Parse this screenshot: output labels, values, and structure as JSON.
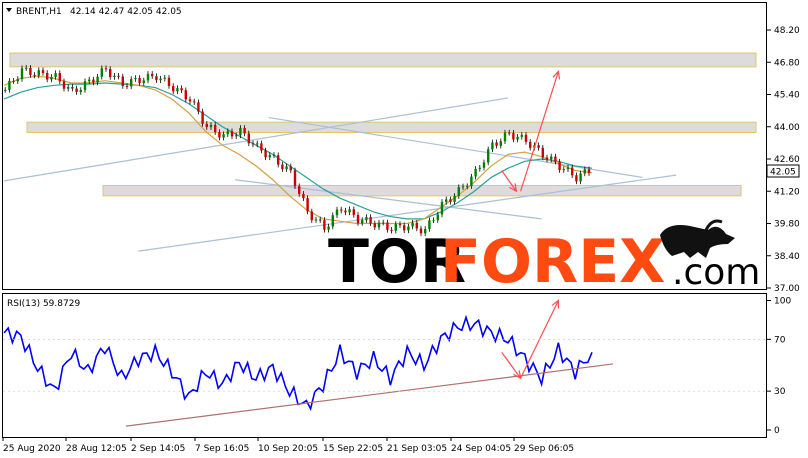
{
  "chart_data": [
    {
      "type": "candlestick",
      "title": "BRENT,H1",
      "ohlc_label": "42.14 42.47 42.05 42.05",
      "last_price": "42.05",
      "y_ticks": [
        "48.20",
        "46.80",
        "45.40",
        "44.00",
        "42.60",
        "41.20",
        "39.80",
        "38.40",
        "37.00"
      ],
      "ylim": [
        37.0,
        48.2
      ],
      "x_ticks": [
        "25 Aug 2020",
        "28 Aug 12:05",
        "2 Sep 14:05",
        "7 Sep 16:05",
        "10 Sep 20:05",
        "15 Sep 22:05",
        "21 Sep 03:05",
        "24 Sep 04:05",
        "29 Sep 06:05"
      ],
      "x": [
        0,
        4,
        8,
        12,
        16,
        20,
        24,
        28,
        32,
        36,
        40,
        44,
        48,
        52,
        56,
        60,
        64,
        68,
        72,
        76,
        80,
        84,
        88,
        92,
        96,
        100,
        104,
        108,
        112,
        116,
        120,
        124,
        128,
        132,
        136,
        140
      ],
      "close": [
        45.6,
        46.45,
        46.3,
        46.15,
        45.5,
        45.95,
        46.5,
        45.85,
        46.05,
        46.2,
        45.7,
        45.2,
        44.0,
        43.6,
        43.8,
        43.1,
        42.6,
        42.0,
        40.3,
        39.6,
        40.5,
        40.0,
        39.8,
        39.6,
        39.7,
        39.5,
        40.6,
        41.2,
        42.0,
        43.2,
        43.7,
        43.4,
        42.8,
        42.3,
        41.8,
        42.2
      ],
      "series": [
        {
          "name": "",
          "color": "#2aa198",
          "values": [
            45.2,
            45.5,
            45.7,
            45.8,
            45.85,
            45.85,
            45.9,
            45.85,
            45.8,
            45.7,
            45.4,
            45.0,
            44.5,
            44.0,
            43.6,
            43.2,
            42.8,
            42.3,
            41.8,
            41.3,
            40.9,
            40.6,
            40.3,
            40.1,
            40.0,
            40.0,
            40.3,
            40.7,
            41.2,
            41.8,
            42.2,
            42.5,
            42.6,
            42.5,
            42.3,
            42.2
          ]
        },
        {
          "name": "",
          "color": "#d4a040",
          "values": [
            45.8,
            46.1,
            46.2,
            46.1,
            45.9,
            45.9,
            46.0,
            45.9,
            45.8,
            45.6,
            45.2,
            44.6,
            43.8,
            43.2,
            42.8,
            42.3,
            41.7,
            41.0,
            40.4,
            40.0,
            39.9,
            39.8,
            39.8,
            39.8,
            39.8,
            40.0,
            40.5,
            41.0,
            41.6,
            42.3,
            42.8,
            42.9,
            42.7,
            42.4,
            42.1,
            42.0
          ]
        }
      ],
      "zones": [
        {
          "name": "resistance-zone-top",
          "low": 46.6,
          "high": 47.2
        },
        {
          "name": "resistance-zone-middle",
          "low": 43.75,
          "high": 44.2
        },
        {
          "name": "support-zone",
          "low": 41.0,
          "high": 41.45
        }
      ],
      "trendlines": [
        {
          "name": "upper-channel-line",
          "from": [
            0,
            41.65
          ],
          "to": [
            120,
            45.25
          ]
        },
        {
          "name": "lower-channel-line",
          "from": [
            32,
            38.6
          ],
          "to": [
            160,
            41.9
          ]
        },
        {
          "name": "descending-line-upper",
          "from": [
            63,
            44.4
          ],
          "to": [
            152,
            41.8
          ]
        },
        {
          "name": "descending-line-lower",
          "from": [
            55,
            41.7
          ],
          "to": [
            128,
            40.0
          ]
        }
      ],
      "arrows": [
        {
          "from": [
            118.5,
            42.1
          ],
          "to": [
            122,
            41.2
          ]
        },
        {
          "from": [
            123,
            41.2
          ],
          "to": [
            132,
            46.4
          ]
        }
      ],
      "watermark": {
        "part1": "TOR",
        "part2": "FOREX",
        "part3": ".com"
      }
    },
    {
      "type": "line",
      "title": "RSI(13) 59.8729",
      "ylim": [
        0,
        100
      ],
      "y_ticks": [
        "100",
        "70",
        "30",
        "0"
      ],
      "x": [
        0,
        4,
        8,
        12,
        16,
        20,
        24,
        28,
        32,
        36,
        40,
        44,
        48,
        52,
        56,
        60,
        64,
        68,
        72,
        76,
        80,
        84,
        88,
        92,
        96,
        100,
        104,
        108,
        112,
        116,
        120,
        124,
        128,
        132,
        136,
        140
      ],
      "values": [
        75,
        72,
        48,
        30,
        60,
        45,
        65,
        40,
        55,
        60,
        45,
        25,
        45,
        35,
        52,
        40,
        48,
        30,
        18,
        35,
        60,
        45,
        55,
        40,
        60,
        50,
        70,
        80,
        82,
        75,
        70,
        55,
        40,
        62,
        45,
        60
      ],
      "color": "#0000ff",
      "trendlines": [
        {
          "name": "rsi-support-line",
          "from": [
            29,
            3
          ],
          "to": [
            145,
            51
          ]
        }
      ],
      "arrows": [
        {
          "from": [
            118.5,
            60
          ],
          "to": [
            123,
            40
          ]
        },
        {
          "from": [
            123,
            40
          ],
          "to": [
            132,
            100
          ]
        }
      ]
    }
  ]
}
